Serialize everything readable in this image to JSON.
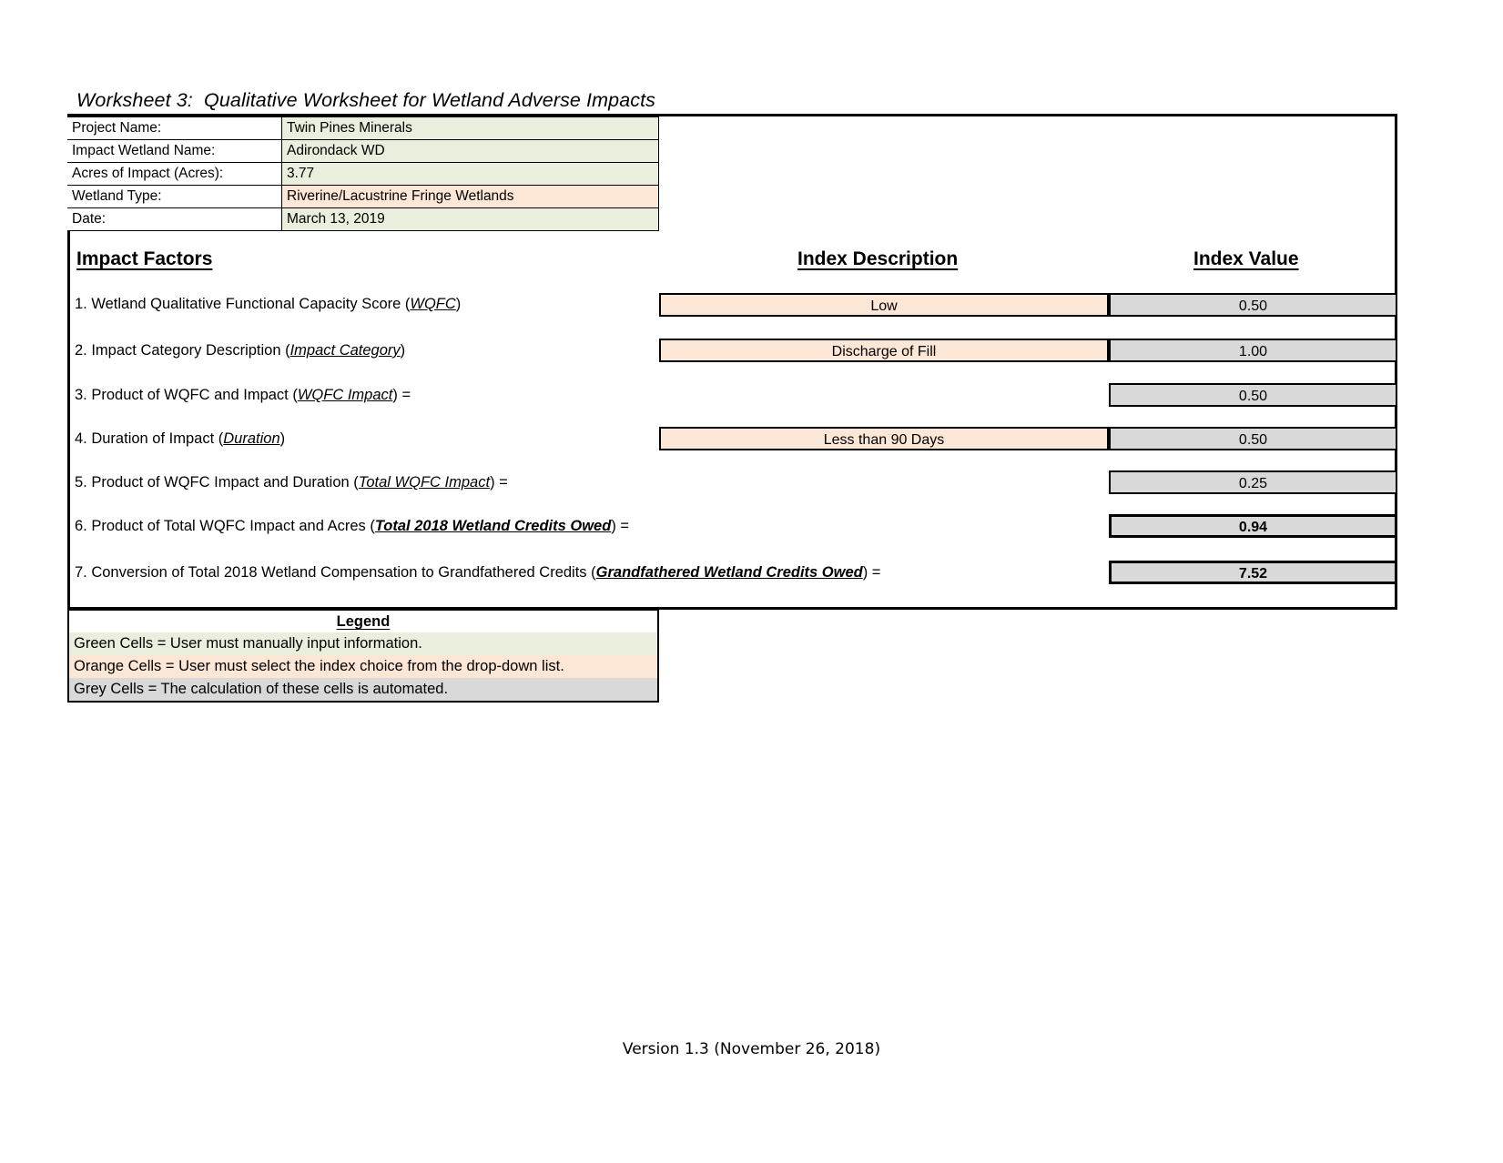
{
  "worksheet": {
    "title": "Worksheet 3:  Qualitative Worksheet for Wetland Adverse Impacts"
  },
  "info": {
    "rows": [
      {
        "label": "Project Name:",
        "value": "Twin Pines Minerals",
        "fill": "green"
      },
      {
        "label": "Impact Wetland Name:",
        "value": "Adirondack WD",
        "fill": "green"
      },
      {
        "label": "Acres of Impact (Acres):",
        "value": "3.77",
        "fill": "green"
      },
      {
        "label": "Wetland Type:",
        "value": "Riverine/Lacustrine Fringe Wetlands",
        "fill": "orange"
      },
      {
        "label": "Date:",
        "value": "March 13, 2019",
        "fill": "green"
      }
    ]
  },
  "headings": {
    "impact_factors": "Impact Factors",
    "index_description": "Index Description",
    "index_value": "Index Value"
  },
  "factors": [
    {
      "number": "1.",
      "text_before": "1. Wetland Qualitative Functional Capacity Score (",
      "term": "WQFC",
      "text_after": ")",
      "description": "Low",
      "value": "0.50",
      "has_description": true,
      "bold_value": false
    },
    {
      "number": "2.",
      "text_before": "2. Impact Category Description (",
      "term": "Impact Category",
      "text_after": ")",
      "description": "Discharge of Fill",
      "value": "1.00",
      "has_description": true,
      "bold_value": false
    },
    {
      "number": "3.",
      "text_before": "3. Product of WQFC and Impact (",
      "term": "WQFC Impact",
      "text_after": ") =",
      "description": "",
      "value": "0.50",
      "has_description": false,
      "bold_value": false
    },
    {
      "number": "4.",
      "text_before": "4. Duration of Impact (",
      "term": "Duration",
      "text_after": ")",
      "description": "Less than 90 Days",
      "value": "0.50",
      "has_description": true,
      "bold_value": false
    },
    {
      "number": "5.",
      "text_before": "5. Product of WQFC Impact and Duration (",
      "term": "Total WQFC Impact",
      "text_after": ") =",
      "description": "",
      "value": "0.25",
      "has_description": false,
      "bold_value": false
    },
    {
      "number": "6.",
      "text_before": "6. Product of Total WQFC Impact and Acres (",
      "term": "Total 2018 Wetland Credits Owed",
      "text_after": ") =",
      "description": "",
      "value": "0.94",
      "has_description": false,
      "bold_value": true
    },
    {
      "number": "7.",
      "text_before": "7. Conversion of Total 2018 Wetland Compensation to Grandfathered Credits (",
      "term": "Grandfathered Wetland Credits Owed",
      "text_after": ") =",
      "description": "",
      "value": "7.52",
      "has_description": false,
      "bold_value": true
    }
  ],
  "legend": {
    "title": "Legend",
    "green": "Green Cells = User must manually input information.",
    "orange": "Orange Cells = User must select the index choice from the drop-down list.",
    "grey": "Grey Cells = The calculation of these cells is automated."
  },
  "footer": {
    "version": "Version 1.3 (November 26, 2018)"
  },
  "colors": {
    "green_fill": "#e9eedd",
    "orange_fill": "#fce7d6",
    "grey_fill": "#d9d9d9",
    "border": "#000000"
  }
}
